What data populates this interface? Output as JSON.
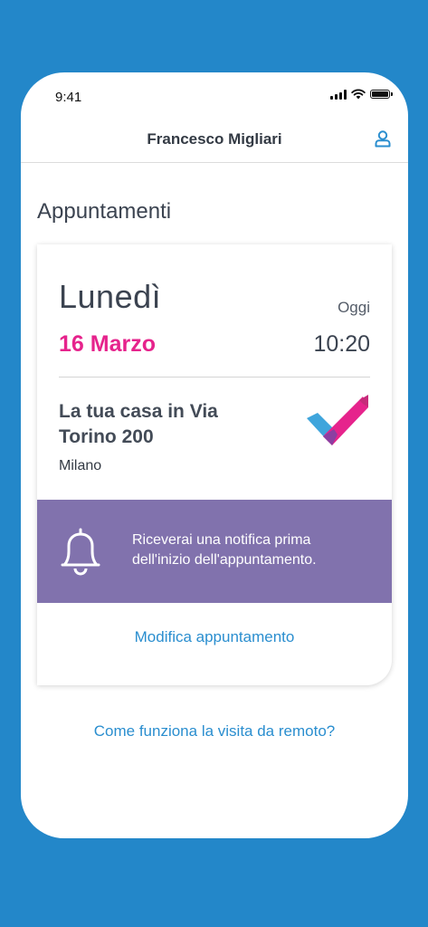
{
  "status_bar": {
    "time": "9:41"
  },
  "header": {
    "title": "Francesco Migliari",
    "profile_icon": "user-icon"
  },
  "page": {
    "section_title": "Appuntamenti"
  },
  "appointment": {
    "day": "Lunedì",
    "today_label": "Oggi",
    "date": "16 Marzo",
    "time": "10:20",
    "address": "La tua casa in Via Torino 200",
    "city": "Milano",
    "notification_text": "Riceverai una notifica prima dell'inizio dell'appuntamento.",
    "edit_link": "Modifica appuntamento"
  },
  "footer": {
    "remote_link": "Come funziona la visita da remoto?"
  },
  "colors": {
    "background": "#2387c9",
    "accent_pink": "#e6238c",
    "notification_bg": "#8172ad",
    "link": "#2a8ecf"
  }
}
